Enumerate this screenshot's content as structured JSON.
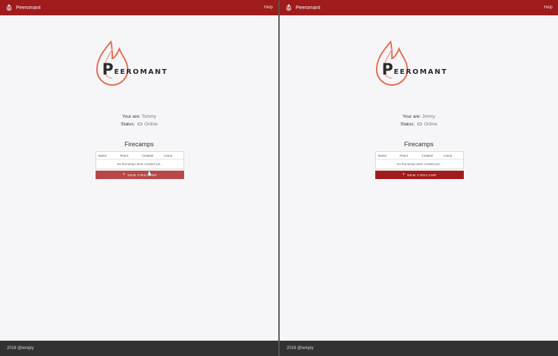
{
  "colors": {
    "primary": "#a01b1b",
    "footer": "#323232",
    "background": "#f6f5f7",
    "flame_outer": "#e46a4c",
    "flame_inner": "#f3a58a"
  },
  "panes": [
    {
      "topbar": {
        "app_name": "Peeromant",
        "help_label": "Help"
      },
      "logo": {
        "initial": "P",
        "rest": "EEROMANT"
      },
      "identity": {
        "user_key": "Your are:",
        "user_value": "Tommy",
        "status_key": "Status:",
        "status_value": "Online"
      },
      "firecamps": {
        "title": "Firecamps",
        "columns": [
          "Name",
          "Peers",
          "Created",
          "Action"
        ],
        "empty_message": "No firecamps were created yet...",
        "new_button_label": "NEW FIRECAMP",
        "button_hovered": true
      },
      "footer": {
        "text": "2018 @lempiy"
      }
    },
    {
      "topbar": {
        "app_name": "Peeromant",
        "help_label": "Help"
      },
      "logo": {
        "initial": "P",
        "rest": "EEROMANT"
      },
      "identity": {
        "user_key": "Your are:",
        "user_value": "Jimmy",
        "status_key": "Status:",
        "status_value": "Online"
      },
      "firecamps": {
        "title": "Firecamps",
        "columns": [
          "Name",
          "Peers",
          "Created",
          "Action"
        ],
        "empty_message": "No firecamps were created yet...",
        "new_button_label": "NEW FIRECAMP",
        "button_hovered": false
      },
      "footer": {
        "text": "2018 @lempiy"
      }
    }
  ],
  "icons": {
    "brand": "flame-icon",
    "status": "status-pill-icon",
    "add": "plus-icon",
    "pointer": "hand-cursor-icon"
  }
}
